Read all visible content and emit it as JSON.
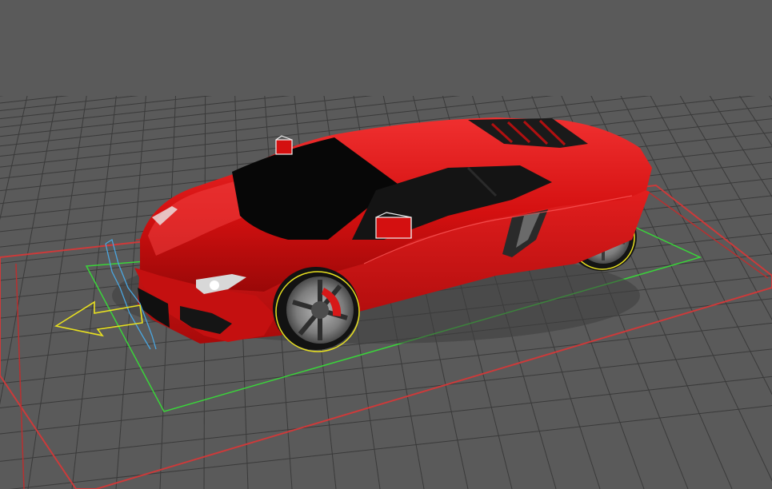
{
  "viewport": {
    "view": "perspective",
    "background_color": "#5a5a5a",
    "grid_color": "#3a3a3a"
  },
  "scene": {
    "object": "car",
    "body_color": "#e01010",
    "glass_color": "#0a0a0a",
    "wheel_color": "#8c8c8c",
    "brake_caliper_color": "#d81818",
    "tire_color": "#151515"
  },
  "helpers": {
    "outer_boundary_color": "#d03030",
    "inner_boundary_color": "#33cc33",
    "direction_arrow_color": "#e8e020",
    "front_plane_color": "#4aa6e0",
    "wheel_selection_color": "#e8e020",
    "mirror_gizmo_color": "#f0f0f0"
  }
}
